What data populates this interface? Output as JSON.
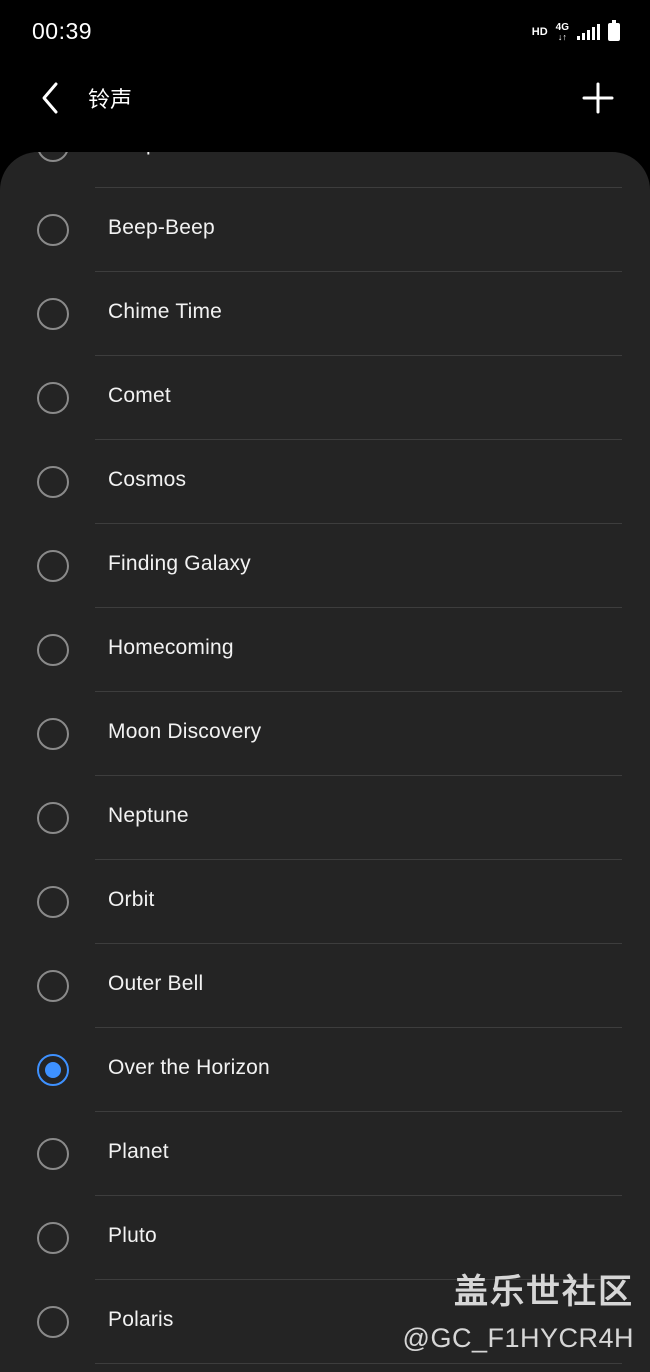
{
  "status_bar": {
    "time": "00:39",
    "hd": "HD",
    "network": "4G",
    "network_arrows": "↓↑"
  },
  "app_bar": {
    "title": "铃声",
    "back_icon": "back-chevron-icon",
    "add_icon": "plus-icon"
  },
  "ringtones": [
    {
      "label": "Beep Once",
      "selected": false
    },
    {
      "label": "Beep-Beep",
      "selected": false
    },
    {
      "label": "Chime Time",
      "selected": false
    },
    {
      "label": "Comet",
      "selected": false
    },
    {
      "label": "Cosmos",
      "selected": false
    },
    {
      "label": "Finding Galaxy",
      "selected": false
    },
    {
      "label": "Homecoming",
      "selected": false
    },
    {
      "label": "Moon Discovery",
      "selected": false
    },
    {
      "label": "Neptune",
      "selected": false
    },
    {
      "label": "Orbit",
      "selected": false
    },
    {
      "label": "Outer Bell",
      "selected": false
    },
    {
      "label": "Over the Horizon",
      "selected": true
    },
    {
      "label": "Planet",
      "selected": false
    },
    {
      "label": "Pluto",
      "selected": false
    },
    {
      "label": "Polaris",
      "selected": false
    }
  ],
  "watermark": {
    "title": "盖乐世社区",
    "handle": "@GC_F1HYCR4H"
  },
  "colors": {
    "background": "#000000",
    "card": "#242424",
    "accent": "#3e91ff",
    "divider": "#3d3d3d"
  }
}
